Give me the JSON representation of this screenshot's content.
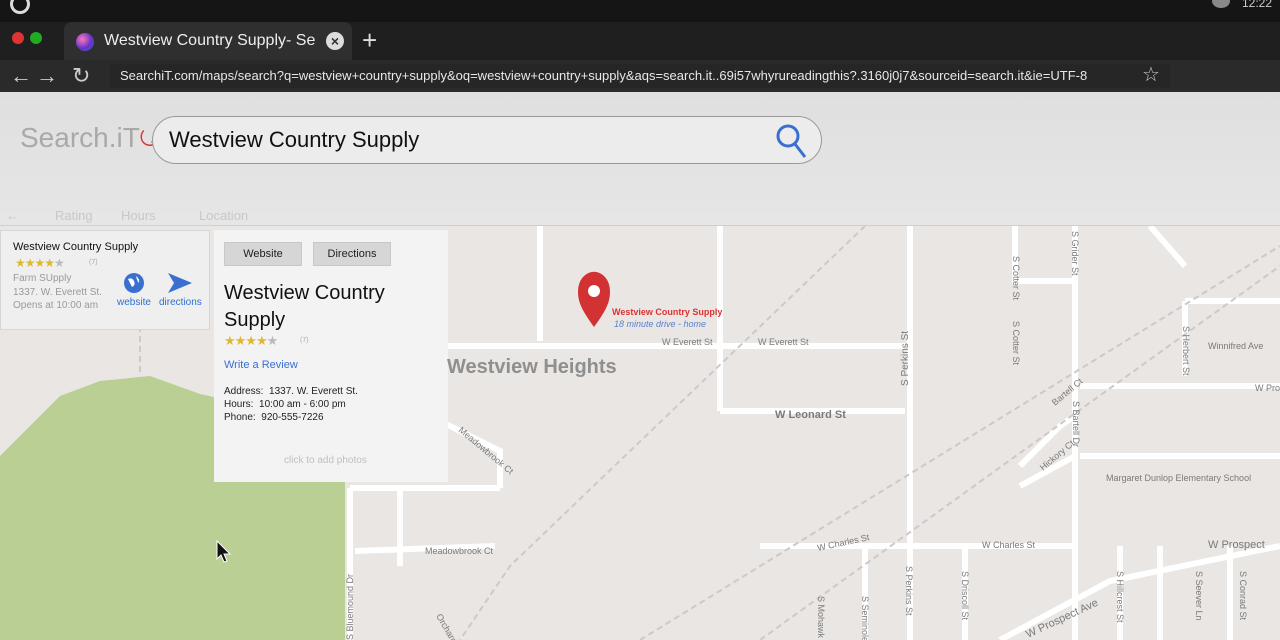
{
  "os": {
    "clock": "12:22"
  },
  "browser": {
    "tab_title": "Westview Country Supply- Search",
    "new_tab": "+",
    "tab_close": "×",
    "url": "SearchiT.com/maps/search?q=westview+country+supply&oq=westview+country+supply&aqs=search.it..69i57whyrureadingthis?.3160j0j7&sourceid=search.it&ie=UTF-8"
  },
  "search": {
    "brand": "Search.iT",
    "query": "Westview Country Supply"
  },
  "filters": {
    "back": "←",
    "items": [
      "Rating",
      "Hours",
      "Location"
    ]
  },
  "result": {
    "name": "Westview Country Supply",
    "rating": 4,
    "review_count": "(7)",
    "category": "Farm SUpply",
    "address": "1337. W. Everett St.",
    "hours": "Opens at 10:00 am",
    "website_label": "website",
    "directions_label": "directions"
  },
  "detail": {
    "website_button": "Website",
    "directions_button": "Directions",
    "title": "Westview Country Supply",
    "rating": 4,
    "review_count": "(7)",
    "write_review": "Write a Review",
    "address_label": "Address:",
    "address": "1337. W. Everett St.",
    "hours_label": "Hours:",
    "hours": "10:00 am - 6:00 pm",
    "phone_label": "Phone:",
    "phone": "920-555-7226",
    "add_photos": "click to add photos"
  },
  "map": {
    "pin_label": "Westview Country Supply",
    "pin_sub": "18 minute drive - home",
    "neighborhood": "Westview Heights",
    "streets": [
      "W Everett St",
      "W Everett St",
      "W Leonard St",
      "S Perkins St",
      "S Perkins St",
      "Meadowbrook Ct",
      "Meadowbrook Ct",
      "S Bluemound Dr",
      "S Cotter St",
      "S Cotter St",
      "S Grider St",
      "Winnifred Ave",
      "W Prospect Ave",
      "W Prospect",
      "W Charles St",
      "W Charles St",
      "S Herbert St",
      "Bartell Ct",
      "Hickory Ct",
      "S Bartell Dr",
      "Margaret Dunlop Elementary School",
      "S Driscoll St",
      "S Hillcrest St",
      "S Seever Ln",
      "S Conrad St",
      "S Mohawk",
      "S Seminole",
      "W Pro",
      "Orchard Ct"
    ],
    "colors": {
      "park": "#b9cf93",
      "road": "#ffffff",
      "rail": "#c9c4c4"
    }
  }
}
